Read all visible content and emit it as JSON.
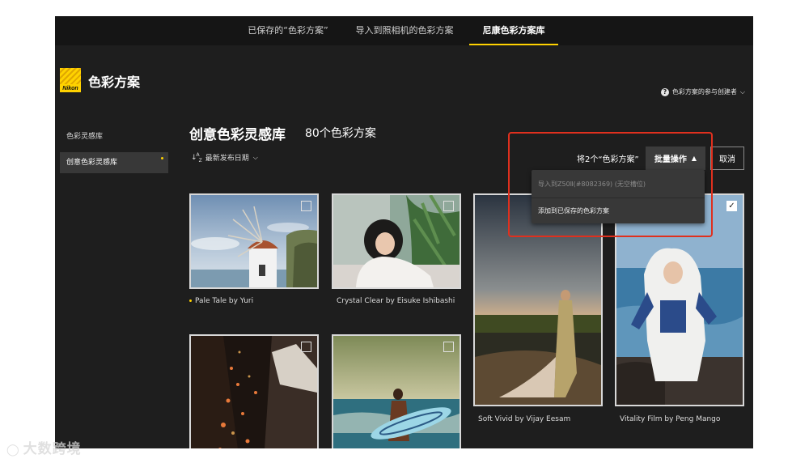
{
  "top_nav": {
    "tabs": [
      {
        "label": "已保存的“色彩方案”",
        "active": false
      },
      {
        "label": "导入到照相机的色彩方案",
        "active": false
      },
      {
        "label": "尼康色彩方案库",
        "active": true
      }
    ]
  },
  "brand": {
    "logo_text": "Nikon",
    "title": "色彩方案"
  },
  "help": {
    "label": "色彩方案的参与创建者",
    "icon": "question-circle-icon"
  },
  "sidebar": {
    "items": [
      {
        "label": "色彩灵感库",
        "active": false
      },
      {
        "label": "创意色彩灵感库",
        "active": true
      }
    ]
  },
  "main": {
    "title": "创意色彩灵感库",
    "count": "80个色彩方案",
    "sort_label": "最新发布日期"
  },
  "toolbar": {
    "selection_count": "将2个“色彩方案”",
    "batch_label": "批量操作",
    "cancel_label": "取消",
    "dropdown": {
      "items": [
        {
          "label": "导入到Z50Ⅱ(#8082369) (无空槽位)",
          "enabled": false
        },
        {
          "label": "添加到已保存的色彩方案",
          "enabled": true
        }
      ]
    }
  },
  "cards": [
    {
      "caption": "Pale Tale by Yuri",
      "checked": false,
      "dot": true
    },
    {
      "caption": "Crystal Clear by Eisuke Ishibashi",
      "checked": false,
      "dot": false
    },
    {
      "caption": "Soft Vivid by Vijay Eesam",
      "checked": true,
      "dot": false
    },
    {
      "caption": "Vitality Film by Peng Mango",
      "checked": true,
      "dot": false
    },
    {
      "caption": "",
      "checked": false,
      "dot": false
    },
    {
      "caption": "",
      "checked": false,
      "dot": false
    }
  ],
  "watermark": {
    "text": "大数跨境"
  },
  "colors": {
    "accent": "#ffd200",
    "highlight": "#e0301e",
    "background": "#1e1e1e"
  }
}
